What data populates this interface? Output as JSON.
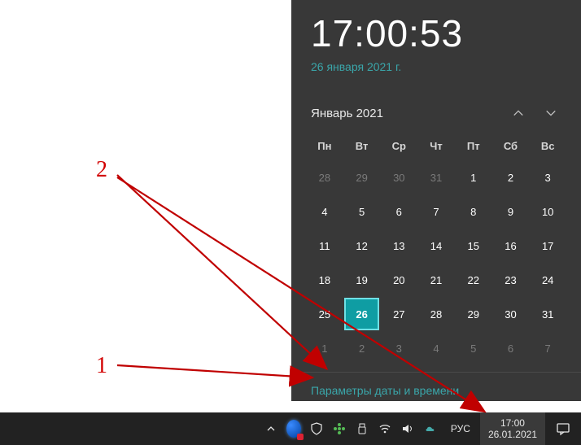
{
  "flyout": {
    "time": "17:00:53",
    "date_long": "26 января 2021 г.",
    "month_label": "Январь 2021",
    "dow": [
      "Пн",
      "Вт",
      "Ср",
      "Чт",
      "Пт",
      "Сб",
      "Вс"
    ],
    "weeks": [
      [
        {
          "d": "28",
          "dim": true
        },
        {
          "d": "29",
          "dim": true
        },
        {
          "d": "30",
          "dim": true
        },
        {
          "d": "31",
          "dim": true
        },
        {
          "d": "1"
        },
        {
          "d": "2"
        },
        {
          "d": "3"
        }
      ],
      [
        {
          "d": "4"
        },
        {
          "d": "5"
        },
        {
          "d": "6"
        },
        {
          "d": "7"
        },
        {
          "d": "8"
        },
        {
          "d": "9"
        },
        {
          "d": "10"
        }
      ],
      [
        {
          "d": "11"
        },
        {
          "d": "12"
        },
        {
          "d": "13"
        },
        {
          "d": "14"
        },
        {
          "d": "15"
        },
        {
          "d": "16"
        },
        {
          "d": "17"
        }
      ],
      [
        {
          "d": "18"
        },
        {
          "d": "19"
        },
        {
          "d": "20"
        },
        {
          "d": "21"
        },
        {
          "d": "22"
        },
        {
          "d": "23"
        },
        {
          "d": "24"
        }
      ],
      [
        {
          "d": "25"
        },
        {
          "d": "26",
          "today": true
        },
        {
          "d": "27"
        },
        {
          "d": "28"
        },
        {
          "d": "29"
        },
        {
          "d": "30"
        },
        {
          "d": "31"
        }
      ],
      [
        {
          "d": "1",
          "dim": true
        },
        {
          "d": "2",
          "dim": true
        },
        {
          "d": "3",
          "dim": true
        },
        {
          "d": "4",
          "dim": true
        },
        {
          "d": "5",
          "dim": true
        },
        {
          "d": "6",
          "dim": true
        },
        {
          "d": "7",
          "dim": true
        }
      ]
    ],
    "settings_link": "Параметры даты и времени"
  },
  "taskbar": {
    "lang": "РУС",
    "clock_time": "17:00",
    "clock_date": "26.01.2021"
  },
  "annotations": {
    "label_1": "1",
    "label_2": "2"
  }
}
